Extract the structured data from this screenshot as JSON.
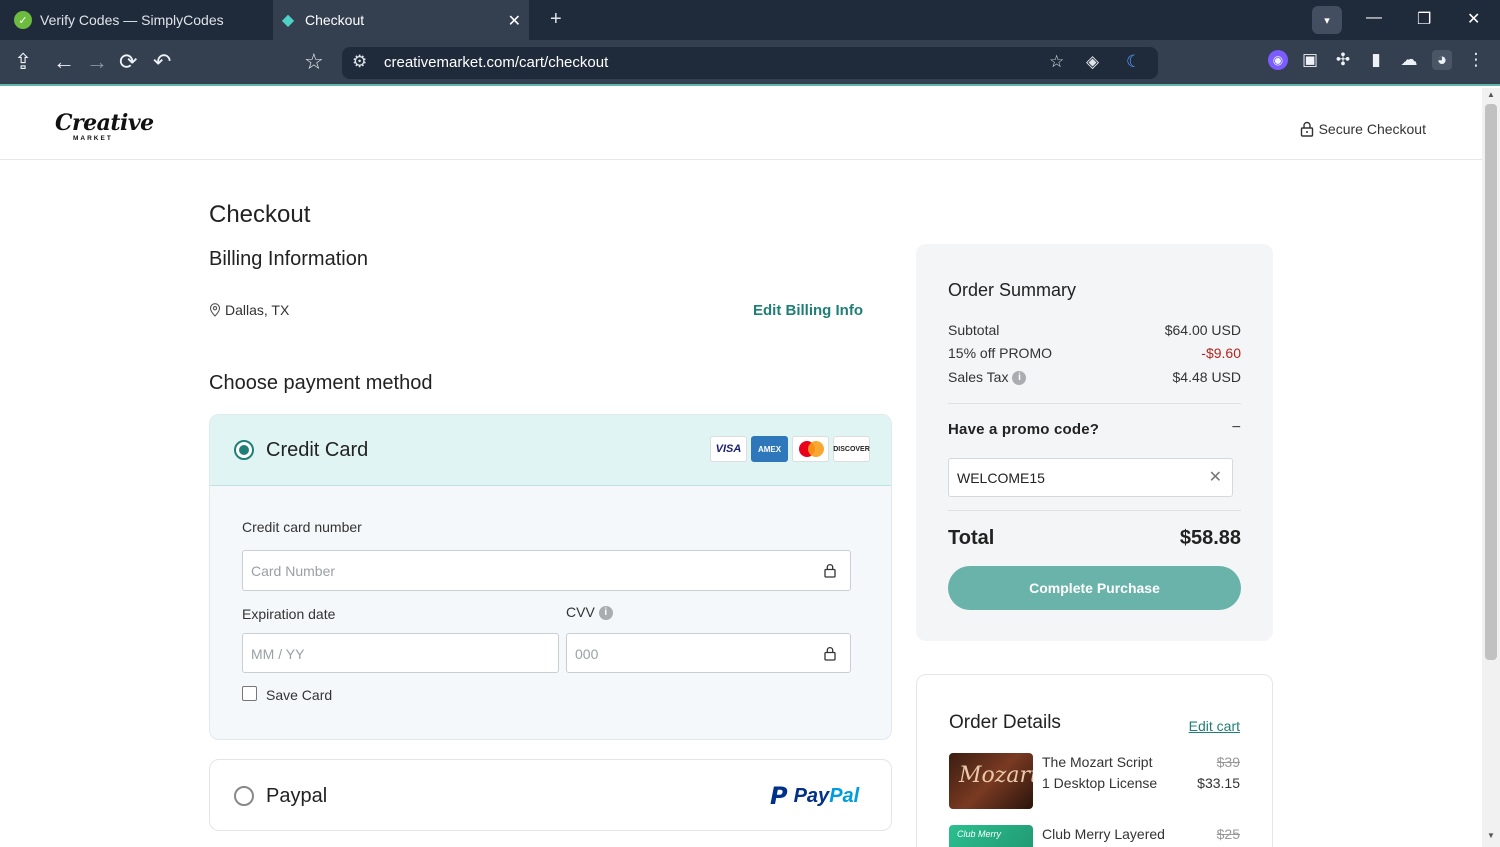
{
  "browser": {
    "tabs": [
      {
        "title": "Verify Codes — SimplyCodes",
        "active": false
      },
      {
        "title": "Checkout",
        "active": true
      }
    ],
    "url": "creativemarket.com/cart/checkout"
  },
  "header": {
    "logo_main": "Creative",
    "logo_sub": "MARKET",
    "secure_label": "Secure Checkout"
  },
  "checkout": {
    "title": "Checkout",
    "billing_title": "Billing Information",
    "location": "Dallas, TX",
    "edit_billing": "Edit Billing Info",
    "payment_title": "Choose payment method",
    "credit_card": {
      "label": "Credit Card",
      "selected": true,
      "card_brands": [
        "VISA",
        "AMEX",
        "MASTERCARD",
        "DISCOVER"
      ],
      "number_label": "Credit card number",
      "number_placeholder": "Card Number",
      "expiry_label": "Expiration date",
      "expiry_placeholder": "MM / YY",
      "cvv_label": "CVV",
      "cvv_placeholder": "000",
      "save_card_label": "Save Card",
      "save_card_checked": false
    },
    "paypal": {
      "label": "Paypal",
      "selected": false,
      "logo_text_a": "Pay",
      "logo_text_b": "Pal"
    }
  },
  "summary": {
    "title": "Order Summary",
    "rows": [
      {
        "label": "Subtotal",
        "value": "$64.00 USD"
      },
      {
        "label": "15% off PROMO",
        "value": "-$9.60"
      },
      {
        "label": "Sales Tax",
        "value": "$4.48 USD"
      }
    ],
    "promo_question": "Have a promo code?",
    "promo_toggle": "−",
    "promo_value": "WELCOME15",
    "total_label": "Total",
    "total_value": "$58.88",
    "button_label": "Complete Purchase"
  },
  "details": {
    "title": "Order Details",
    "edit_cart": "Edit cart",
    "items": [
      {
        "name": "The Mozart Script",
        "license": "1 Desktop License",
        "old_price": "$39",
        "new_price": "$33.15",
        "thumb_text": "Mozart"
      },
      {
        "name": "Club Merry Layered",
        "old_price": "$25",
        "thumb_text": "Club Merry"
      }
    ]
  },
  "colors": {
    "accent": "#1f7f76",
    "button": "#69b3ab",
    "discount": "#b3261e",
    "chrome_dark": "#1f2a3a"
  }
}
